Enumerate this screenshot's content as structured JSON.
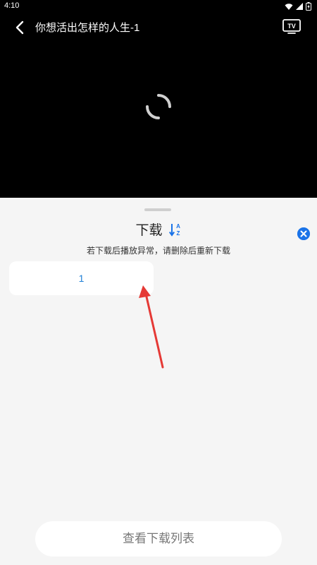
{
  "status_bar": {
    "time": "4:10",
    "icons": [
      "wifi-icon",
      "cell-signal-icon",
      "battery-icon"
    ]
  },
  "player": {
    "title": "你想活出怎样的人生-1",
    "back_icon": "chevron-left-icon",
    "tv_icon": "tv-cast-icon",
    "tv_label": "TV",
    "loading": true
  },
  "sheet": {
    "title": "下载",
    "sort_icon": "sort-az-icon",
    "sort_letters": [
      "A",
      "Z"
    ],
    "notice": "若下载后播放异常，请删除后重新下载",
    "close_icon": "close-icon",
    "episodes": [
      {
        "label": "1"
      }
    ],
    "annotation": "red-arrow-pointing-to-episode",
    "view_list_button": "查看下载列表"
  },
  "colors": {
    "accent": "#1a73e8",
    "episode_text": "#1e7fd6",
    "annotation_arrow": "#e53935",
    "sheet_bg": "#f5f5f5",
    "player_bg": "#000000"
  }
}
